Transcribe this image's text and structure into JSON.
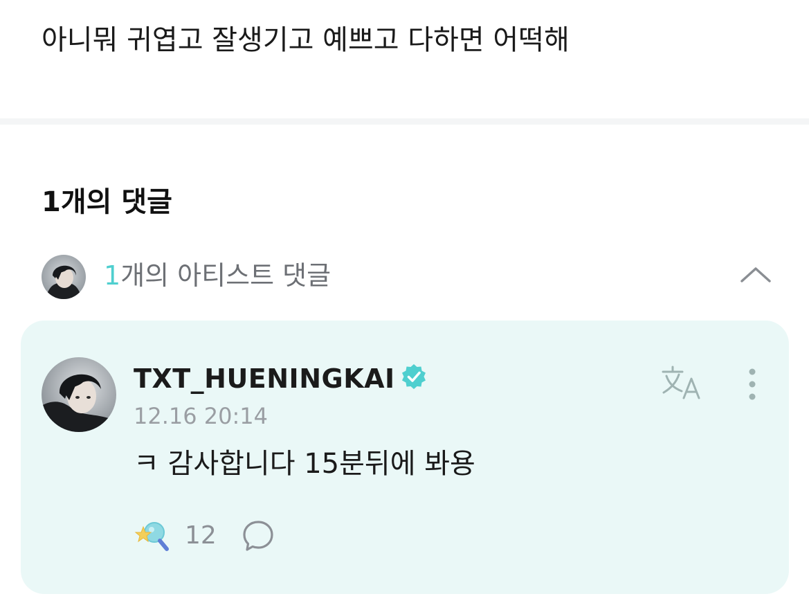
{
  "post": {
    "body_text": "아니뭐 귀엽고 잘생기고 예쁘고 다하면 어떡해"
  },
  "comments": {
    "heading": "1개의 댓글",
    "artist_summary": {
      "count": "1",
      "label_suffix": "개의 아티스트 댓글",
      "accent_color": "#4fcfcf"
    },
    "items": [
      {
        "author": "TXT_HUENINGKAI",
        "verified": true,
        "timestamp": "12.16 20:14",
        "text": "ㅋ 감사합니다 15분뒤에 봐용",
        "reaction_count": "12",
        "icons": {
          "verified": "verified-badge-icon",
          "translate": "translate-icon",
          "more": "more-vertical-icon",
          "reaction": "cheer-light-stick-icon",
          "reply": "reply-bubble-icon"
        }
      }
    ]
  },
  "colors": {
    "card_background": "#eaf8f7",
    "accent": "#4fcfcf",
    "muted_text": "#9a9ea3",
    "divider": "#f4f5f6"
  }
}
